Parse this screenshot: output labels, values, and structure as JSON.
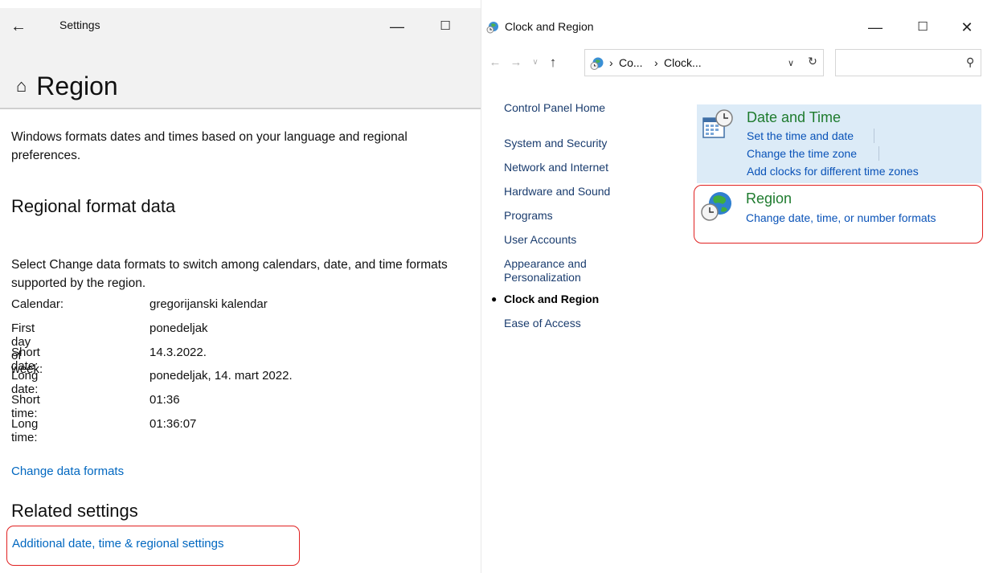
{
  "settings": {
    "app_title": "Settings",
    "page_title": "Region",
    "description": "Windows formats dates and times based on your language and regional preferences.",
    "section_title": "Regional format data",
    "section_description": "Select Change data formats to switch among calendars, date, and time formats supported by the region.",
    "formats": [
      {
        "label": "Calendar:",
        "value": "gregorijanski kalendar"
      },
      {
        "label": "First day of week:",
        "value": "ponedeljak"
      },
      {
        "label": "Short date:",
        "value": "14.3.2022."
      },
      {
        "label": "Long date:",
        "value": "ponedeljak, 14. mart 2022."
      },
      {
        "label": "Short time:",
        "value": "01:36"
      },
      {
        "label": "Long time:",
        "value": "01:36:07"
      }
    ],
    "change_link": "Change data formats",
    "related_title": "Related settings",
    "additional_link": "Additional date, time & regional settings"
  },
  "control_panel": {
    "window_title": "Clock and Region",
    "breadcrumb": [
      "Co...",
      "Clock..."
    ],
    "sidebar": [
      {
        "label": "Control Panel Home",
        "current": false
      },
      {
        "label": "System and Security",
        "current": false
      },
      {
        "label": "Network and Internet",
        "current": false
      },
      {
        "label": "Hardware and Sound",
        "current": false
      },
      {
        "label": "Programs",
        "current": false
      },
      {
        "label": "User Accounts",
        "current": false
      },
      {
        "label": "Appearance and",
        "label2": "Personalization",
        "current": false
      },
      {
        "label": "Clock and Region",
        "current": true
      },
      {
        "label": "Ease of Access",
        "current": false
      }
    ],
    "categories": [
      {
        "title": "Date and Time",
        "links": [
          "Set the time and date",
          "Change the time zone",
          "Add clocks for different time zones"
        ],
        "icon": "calendar-clock-icon"
      },
      {
        "title": "Region",
        "links": [
          "Change date, time, or number formats"
        ],
        "icon": "globe-clock-icon"
      }
    ]
  },
  "colors": {
    "link_blue": "#0067c0",
    "cp_link": "#0a53b8",
    "category_green": "#1e7b2e",
    "highlight_red": "#e02020",
    "category_bg": "#dcebf7"
  }
}
